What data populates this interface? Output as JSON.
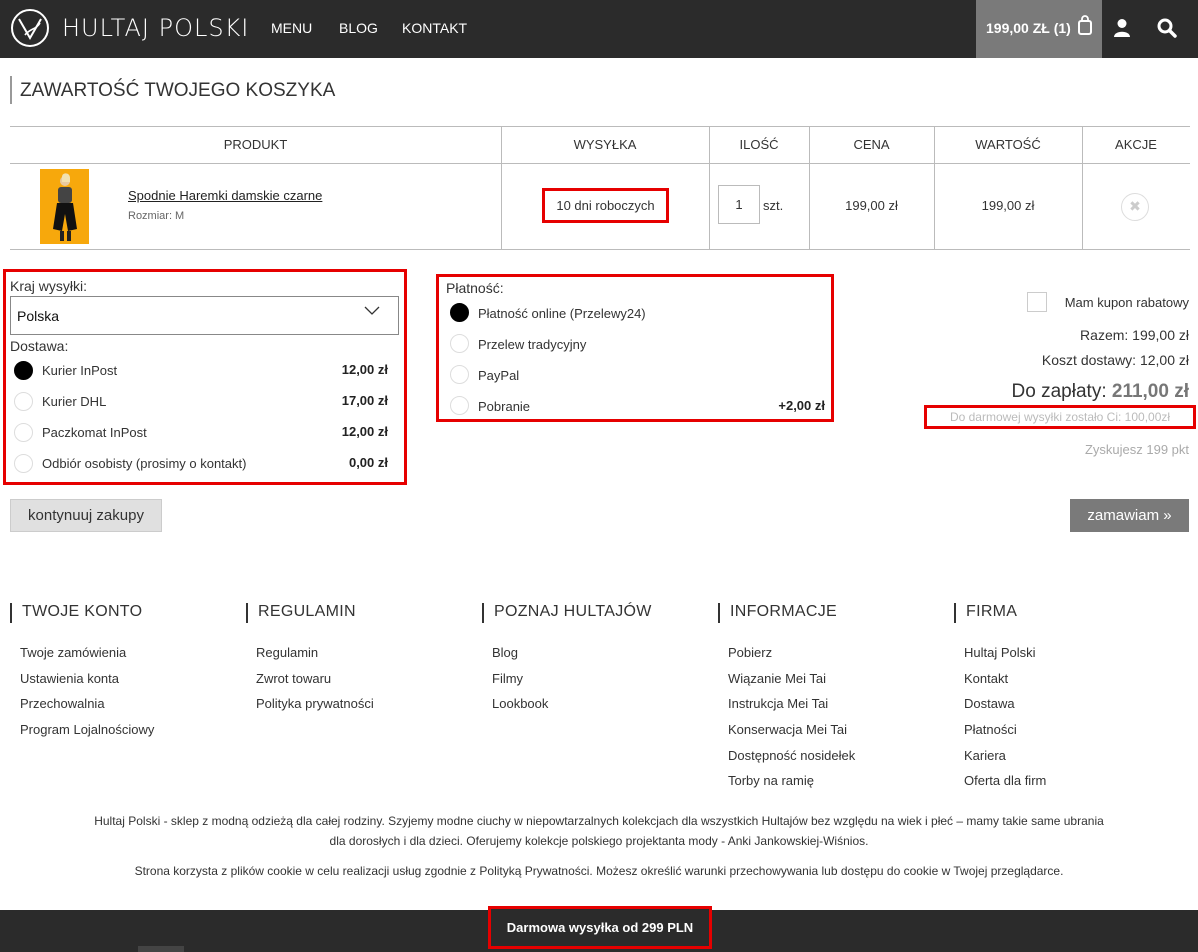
{
  "header": {
    "brand": "HULTAJ POLSKI",
    "nav": [
      "MENU",
      "BLOG",
      "KONTAKT"
    ],
    "cart_label": "199,00 ZŁ (1)"
  },
  "cart": {
    "title": "ZAWARTOŚĆ TWOJEGO KOSZYKA",
    "columns": [
      "PRODUKT",
      "WYSYŁKA",
      "ILOŚĆ",
      "CENA",
      "WARTOŚĆ",
      "AKCJE"
    ],
    "item": {
      "name": "Spodnie Haremki damskie czarne",
      "size": "Rozmiar: M",
      "shipping_time": "10 dni roboczych",
      "quantity": "1",
      "unit": "szt.",
      "price": "199,00 zł",
      "value": "199,00 zł",
      "remove_symbol": "✖"
    }
  },
  "shipping": {
    "country_label": "Kraj wysyłki:",
    "country_value": "Polska",
    "delivery_label": "Dostawa:",
    "options": [
      {
        "label": "Kurier InPost",
        "price": "12,00 zł",
        "selected": true
      },
      {
        "label": "Kurier DHL",
        "price": "17,00 zł",
        "selected": false
      },
      {
        "label": "Paczkomat InPost",
        "price": "12,00 zł",
        "selected": false
      },
      {
        "label": "Odbiór osobisty (prosimy o kontakt)",
        "price": "0,00 zł",
        "selected": false
      }
    ]
  },
  "payment": {
    "label": "Płatność:",
    "options": [
      {
        "label": "Płatność online (Przelewy24)",
        "price": "",
        "selected": true
      },
      {
        "label": "Przelew tradycyjny",
        "price": "",
        "selected": false
      },
      {
        "label": "PayPal",
        "price": "",
        "selected": false
      },
      {
        "label": "Pobranie",
        "price": "+2,00 zł",
        "selected": false
      }
    ]
  },
  "summary": {
    "coupon": "Mam kupon rabatowy",
    "subtotal": "Razem: 199,00 zł",
    "delivery_cost": "Koszt dostawy: 12,00 zł",
    "to_pay_label": "Do zapłaty:",
    "to_pay_value": "211,00 zł",
    "free_shipping_note": "Do darmowej wysyłki zostało Ci: 100,00zł",
    "points": "Zyskujesz 199 pkt"
  },
  "buttons": {
    "continue": "kontynuuj zakupy",
    "order": "zamawiam »"
  },
  "footer": {
    "columns": [
      {
        "title": "TWOJE KONTO",
        "links": [
          "Twoje zamówienia",
          "Ustawienia konta",
          "Przechowalnia",
          "Program Lojalnościowy"
        ]
      },
      {
        "title": "REGULAMIN",
        "links": [
          "Regulamin",
          "Zwrot towaru",
          "Polityka prywatności"
        ]
      },
      {
        "title": "POZNAJ HULTAJÓW",
        "links": [
          "Blog",
          "Filmy",
          "Lookbook"
        ]
      },
      {
        "title": "INFORMACJE",
        "links": [
          "Pobierz",
          "Wiązanie Mei Tai",
          "Instrukcja Mei Tai",
          "Konserwacja Mei Tai",
          "Dostępność nosidełek",
          "Torby na ramię"
        ]
      },
      {
        "title": "FIRMA",
        "links": [
          "Hultaj Polski",
          "Kontakt",
          "Dostawa",
          "Płatności",
          "Kariera",
          "Oferta dla firm"
        ]
      }
    ],
    "about_line1": "Hultaj Polski - sklep z modną odzieżą dla całej rodziny. Szyjemy modne ciuchy w niepowtarzalnych kolekcjach dla wszystkich Hultajów bez względu na wiek i płeć – mamy takie same ubrania",
    "about_line2": "dla dorosłych i dla dzieci. Oferujemy kolekcje polskiego projektanta mody - Anki Jankowskiej-Wiśnios.",
    "cookie": "Strona korzysta z plików cookie w celu realizacji usług zgodnie z Polityką Prywatności. Możesz określić warunki przechowywania lub dostępu do cookie w Twojej przeglądarce.",
    "free_shipping_banner": "Darmowa wysyłka od 299 PLN"
  },
  "icons": [
    "logo-icon",
    "shopping-bag-icon",
    "user-icon",
    "search-icon",
    "chevron-down-icon",
    "remove-icon"
  ],
  "colors": {
    "header_bg": "#2b2b2b",
    "highlight": "#e60000",
    "cart_bg": "#7a7a7a",
    "product_bg": "#f7a80c"
  }
}
